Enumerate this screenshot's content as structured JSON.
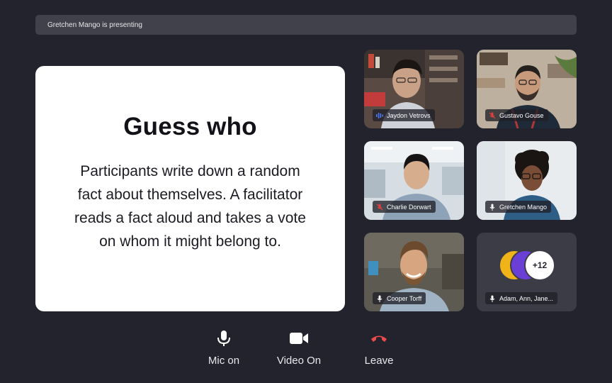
{
  "banner": {
    "text": "Gretchen Mango is presenting"
  },
  "shared_content": {
    "title": "Guess who",
    "body": "Participants write down a random fact about themselves. A facilitator reads a fact aloud and takes a vote on whom it might belong to."
  },
  "participants": [
    {
      "name": "Jaydon Vetrovs",
      "mic_state": "speaking",
      "icon": "audio-wave-icon"
    },
    {
      "name": "Gustavo Gouse",
      "mic_state": "muted",
      "icon": "mic-off-icon"
    },
    {
      "name": "Charlie Dorwart",
      "mic_state": "muted",
      "icon": "mic-off-icon"
    },
    {
      "name": "Gretchen Mango",
      "mic_state": "on",
      "icon": "mic-icon"
    },
    {
      "name": "Cooper Torff",
      "mic_state": "on",
      "icon": "mic-icon"
    }
  ],
  "overflow_tile": {
    "count_label": "+12",
    "names": "Adam, Ann, Jane..."
  },
  "controls": {
    "mic_label": "Mic on",
    "video_label": "Video On",
    "leave_label": "Leave"
  },
  "colors": {
    "background": "#23232d",
    "speaking": "#4a7dff",
    "muted": "#e0413e",
    "leave": "#ef4b4b"
  }
}
